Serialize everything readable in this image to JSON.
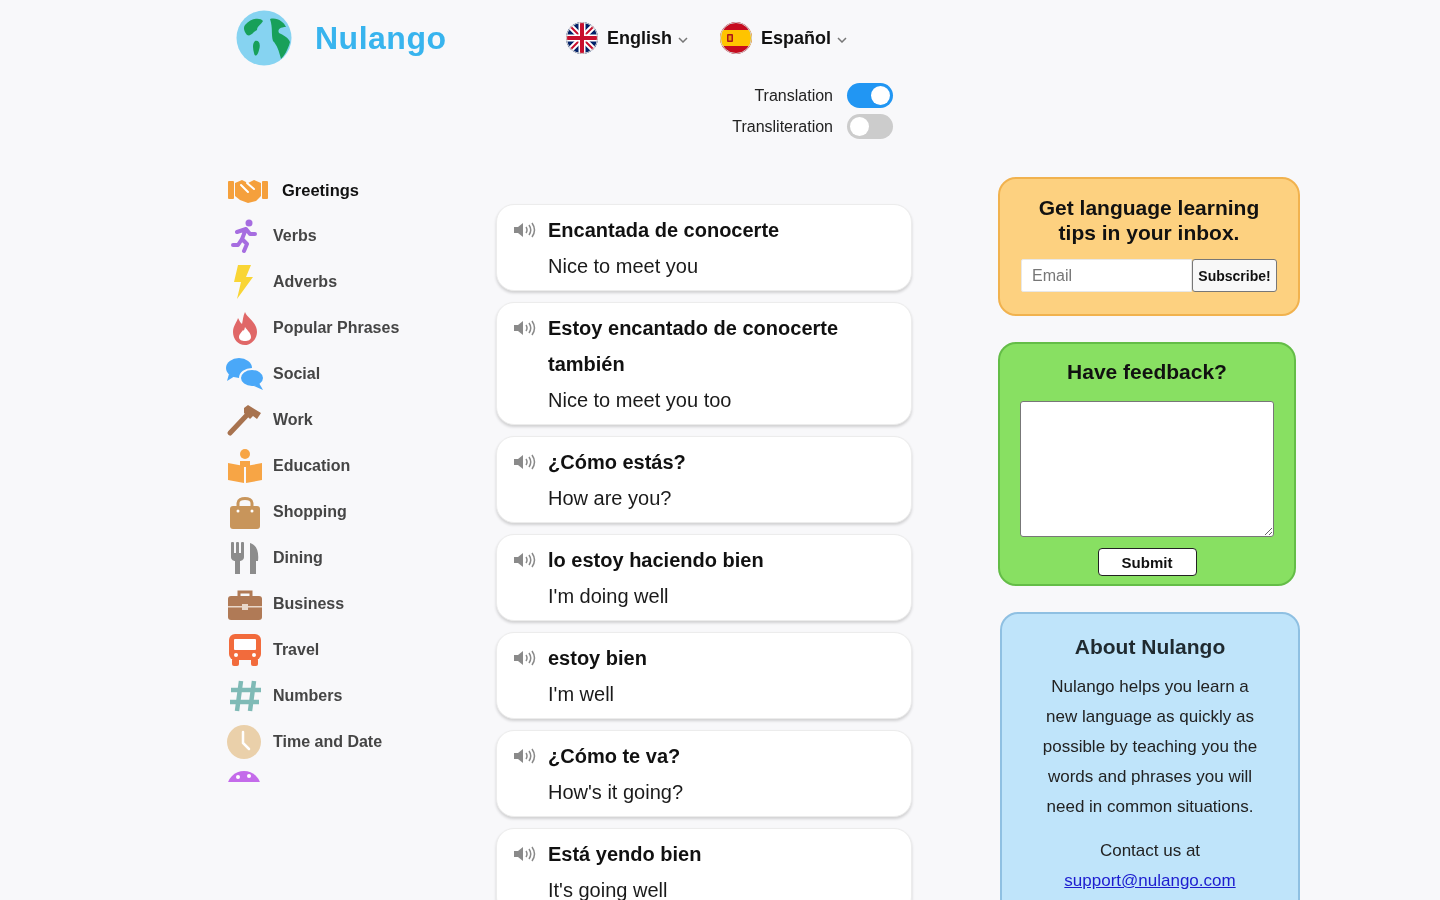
{
  "header": {
    "logo_text": "Nulango",
    "languages": [
      {
        "label": "English"
      },
      {
        "label": "Español"
      }
    ]
  },
  "display_options": [
    {
      "label": "Translation",
      "on": true
    },
    {
      "label": "Transliteration",
      "on": false
    }
  ],
  "categories": [
    {
      "label": "Greetings",
      "selected": true
    },
    {
      "label": "Verbs",
      "selected": false
    },
    {
      "label": "Adverbs",
      "selected": false
    },
    {
      "label": "Popular Phrases",
      "selected": false
    },
    {
      "label": "Social",
      "selected": false
    },
    {
      "label": "Work",
      "selected": false
    },
    {
      "label": "Education",
      "selected": false
    },
    {
      "label": "Shopping",
      "selected": false
    },
    {
      "label": "Dining",
      "selected": false
    },
    {
      "label": "Business",
      "selected": false
    },
    {
      "label": "Travel",
      "selected": false
    },
    {
      "label": "Numbers",
      "selected": false
    },
    {
      "label": "Time and Date",
      "selected": false
    }
  ],
  "phrases": [
    {
      "phrase": "Encantada de conocerte",
      "translation": "Nice to meet you"
    },
    {
      "phrase": "Estoy encantado de conocerte también",
      "translation": "Nice to meet you too"
    },
    {
      "phrase": "¿Cómo estás?",
      "translation": "How are you?"
    },
    {
      "phrase": "lo estoy haciendo bien",
      "translation": "I'm doing well"
    },
    {
      "phrase": "estoy bien",
      "translation": "I'm well"
    },
    {
      "phrase": "¿Cómo te va?",
      "translation": "How's it going?"
    },
    {
      "phrase": "Está yendo bien",
      "translation": "It's going well"
    }
  ],
  "newsletter": {
    "title": "Get language learning tips in your inbox.",
    "placeholder": "Email",
    "button": "Subscribe!"
  },
  "feedback": {
    "title": "Have feedback?",
    "button": "Submit"
  },
  "about": {
    "title": "About Nulango",
    "text": "Nulango helps you learn a new language as quickly as possible by teaching you the words and phrases you will need in common situations.",
    "contact_label": "Contact us at",
    "contact_email": "support@nulango.com"
  }
}
